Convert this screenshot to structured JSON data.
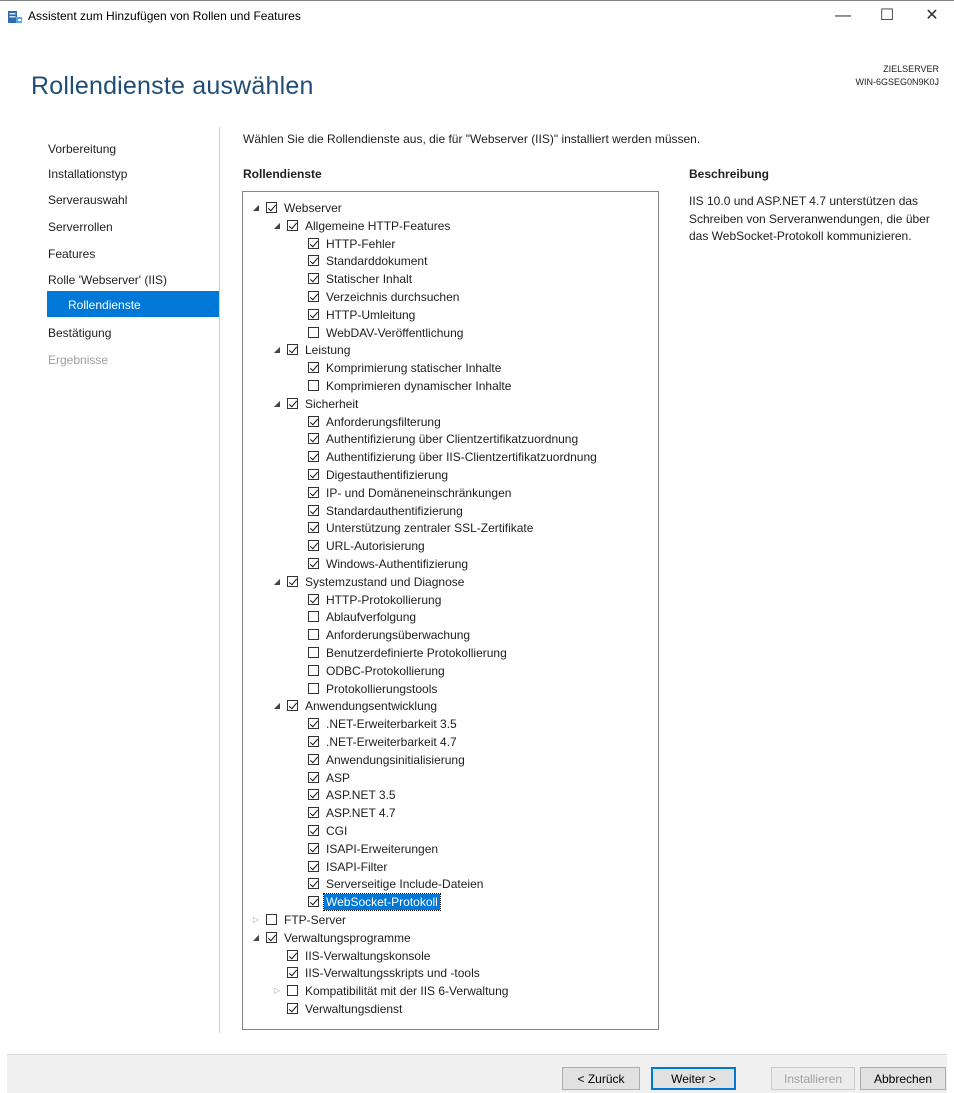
{
  "window": {
    "title": "Assistent zum Hinzufügen von Rollen und Features",
    "minimize_glyph": "—",
    "maximize_glyph": "☐",
    "close_glyph": "✕"
  },
  "header": {
    "page_title": "Rollendienste auswählen",
    "dest_label": "ZIELSERVER",
    "dest_server": "WIN-6GSEG0N9K0J"
  },
  "nav": {
    "items": [
      {
        "label": "Vorbereitung",
        "state": "normal"
      },
      {
        "label": "Installationstyp",
        "state": "normal"
      },
      {
        "label": "Serverauswahl",
        "state": "normal"
      },
      {
        "label": "Serverrollen",
        "state": "normal"
      },
      {
        "label": "Features",
        "state": "normal"
      },
      {
        "label": "Rolle 'Webserver' (IIS)",
        "state": "normal"
      },
      {
        "label": "Rollendienste",
        "state": "active"
      },
      {
        "label": "Bestätigung",
        "state": "normal"
      },
      {
        "label": "Ergebnisse",
        "state": "disabled"
      }
    ]
  },
  "main": {
    "instruction": "Wählen Sie die Rollendienste aus, die für \"Webserver (IIS)\" installiert werden müssen.",
    "tree_header": "Rollendienste",
    "description_header": "Beschreibung",
    "description": "IIS 10.0 und ASP.NET 4.7 unterstützen das Schreiben von Serveranwendungen, die über das WebSocket-Protokoll kommunizieren."
  },
  "tree": [
    {
      "level": 0,
      "label": "Webserver",
      "checked": true,
      "expander": "expanded"
    },
    {
      "level": 1,
      "label": "Allgemeine HTTP-Features",
      "checked": true,
      "expander": "expanded"
    },
    {
      "level": 2,
      "label": "HTTP-Fehler",
      "checked": true,
      "expander": "none"
    },
    {
      "level": 2,
      "label": "Standarddokument",
      "checked": true,
      "expander": "none"
    },
    {
      "level": 2,
      "label": "Statischer Inhalt",
      "checked": true,
      "expander": "none"
    },
    {
      "level": 2,
      "label": "Verzeichnis durchsuchen",
      "checked": true,
      "expander": "none"
    },
    {
      "level": 2,
      "label": "HTTP-Umleitung",
      "checked": true,
      "expander": "none"
    },
    {
      "level": 2,
      "label": "WebDAV-Veröffentlichung",
      "checked": false,
      "expander": "none"
    },
    {
      "level": 1,
      "label": "Leistung",
      "checked": true,
      "expander": "expanded"
    },
    {
      "level": 2,
      "label": "Komprimierung statischer Inhalte",
      "checked": true,
      "expander": "none"
    },
    {
      "level": 2,
      "label": "Komprimieren dynamischer Inhalte",
      "checked": false,
      "expander": "none"
    },
    {
      "level": 1,
      "label": "Sicherheit",
      "checked": true,
      "expander": "expanded"
    },
    {
      "level": 2,
      "label": "Anforderungsfilterung",
      "checked": true,
      "expander": "none"
    },
    {
      "level": 2,
      "label": "Authentifizierung über Clientzertifikatzuordnung",
      "checked": true,
      "expander": "none"
    },
    {
      "level": 2,
      "label": "Authentifizierung über IIS-Clientzertifikatzuordnung",
      "checked": true,
      "expander": "none"
    },
    {
      "level": 2,
      "label": "Digestauthentifizierung",
      "checked": true,
      "expander": "none"
    },
    {
      "level": 2,
      "label": "IP- und Domäneneinschränkungen",
      "checked": true,
      "expander": "none"
    },
    {
      "level": 2,
      "label": "Standardauthentifizierung",
      "checked": true,
      "expander": "none"
    },
    {
      "level": 2,
      "label": "Unterstützung zentraler SSL-Zertifikate",
      "checked": true,
      "expander": "none"
    },
    {
      "level": 2,
      "label": "URL-Autorisierung",
      "checked": true,
      "expander": "none"
    },
    {
      "level": 2,
      "label": "Windows-Authentifizierung",
      "checked": true,
      "expander": "none"
    },
    {
      "level": 1,
      "label": "Systemzustand und Diagnose",
      "checked": true,
      "expander": "expanded"
    },
    {
      "level": 2,
      "label": "HTTP-Protokollierung",
      "checked": true,
      "expander": "none"
    },
    {
      "level": 2,
      "label": "Ablaufverfolgung",
      "checked": false,
      "expander": "none"
    },
    {
      "level": 2,
      "label": "Anforderungsüberwachung",
      "checked": false,
      "expander": "none"
    },
    {
      "level": 2,
      "label": "Benutzerdefinierte Protokollierung",
      "checked": false,
      "expander": "none"
    },
    {
      "level": 2,
      "label": "ODBC-Protokollierung",
      "checked": false,
      "expander": "none"
    },
    {
      "level": 2,
      "label": "Protokollierungstools",
      "checked": false,
      "expander": "none"
    },
    {
      "level": 1,
      "label": "Anwendungsentwicklung",
      "checked": true,
      "expander": "expanded"
    },
    {
      "level": 2,
      "label": ".NET-Erweiterbarkeit 3.5",
      "checked": true,
      "expander": "none"
    },
    {
      "level": 2,
      "label": ".NET-Erweiterbarkeit 4.7",
      "checked": true,
      "expander": "none"
    },
    {
      "level": 2,
      "label": "Anwendungsinitialisierung",
      "checked": true,
      "expander": "none"
    },
    {
      "level": 2,
      "label": "ASP",
      "checked": true,
      "expander": "none"
    },
    {
      "level": 2,
      "label": "ASP.NET 3.5",
      "checked": true,
      "expander": "none"
    },
    {
      "level": 2,
      "label": "ASP.NET 4.7",
      "checked": true,
      "expander": "none"
    },
    {
      "level": 2,
      "label": "CGI",
      "checked": true,
      "expander": "none"
    },
    {
      "level": 2,
      "label": "ISAPI-Erweiterungen",
      "checked": true,
      "expander": "none"
    },
    {
      "level": 2,
      "label": "ISAPI-Filter",
      "checked": true,
      "expander": "none"
    },
    {
      "level": 2,
      "label": "Serverseitige Include-Dateien",
      "checked": true,
      "expander": "none"
    },
    {
      "level": 2,
      "label": "WebSocket-Protokoll",
      "checked": true,
      "expander": "none",
      "selected": true
    },
    {
      "level": 0,
      "label": "FTP-Server",
      "checked": false,
      "expander": "collapsed"
    },
    {
      "level": 0,
      "label": "Verwaltungsprogramme",
      "checked": true,
      "expander": "expanded"
    },
    {
      "level": 1,
      "label": "IIS-Verwaltungskonsole",
      "checked": true,
      "expander": "none"
    },
    {
      "level": 1,
      "label": "IIS-Verwaltungsskripts und -tools",
      "checked": true,
      "expander": "none"
    },
    {
      "level": 1,
      "label": "Kompatibilität mit der IIS 6-Verwaltung",
      "checked": false,
      "expander": "collapsed"
    },
    {
      "level": 1,
      "label": "Verwaltungsdienst",
      "checked": true,
      "expander": "none"
    }
  ],
  "footer": {
    "back_label": "< Zurück",
    "next_label": "Weiter >",
    "install_label": "Installieren",
    "cancel_label": "Abbrechen"
  },
  "icons": {
    "expanded_glyph": "◢",
    "collapsed_glyph": "▷"
  },
  "colors": {
    "accent": "#0078d7",
    "title": "#1e4d78"
  }
}
